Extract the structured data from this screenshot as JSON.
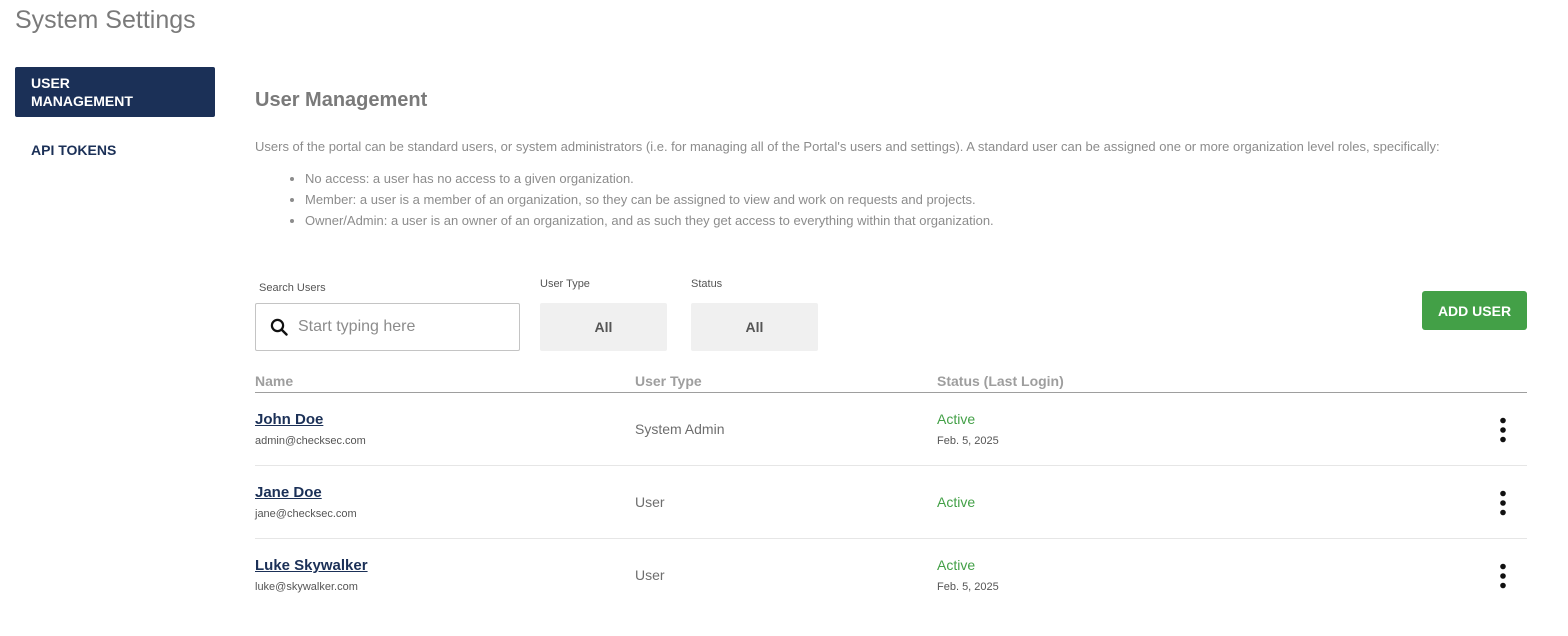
{
  "page": {
    "title": "System Settings"
  },
  "sidebar": {
    "items": [
      {
        "label_line1": "USER",
        "label_line2": "MANAGEMENT",
        "active": true
      },
      {
        "label": "API TOKENS",
        "active": false
      }
    ]
  },
  "main": {
    "title": "User Management",
    "intro": "Users of the portal can be standard users, or system administrators (i.e. for managing all of the Portal's users and settings). A standard user can be assigned one or more organization level roles, specifically:",
    "roles": [
      "No access: a user has no access to a given organization.",
      "Member: a user is a member of an organization, so they can be assigned to view and work on requests and projects.",
      "Owner/Admin: a user is an owner of an organization, and as such they get access to everything within that organization."
    ]
  },
  "filters": {
    "search_label": "Search Users",
    "search_placeholder": "Start typing here",
    "search_value": "",
    "user_type_label": "User Type",
    "user_type_value": "All",
    "status_label": "Status",
    "status_value": "All"
  },
  "actions": {
    "add_user": "ADD USER"
  },
  "table": {
    "columns": [
      "Name",
      "User Type",
      "Status (Last Login)"
    ],
    "rows": [
      {
        "name": "John Doe",
        "email": "admin@checksec.com",
        "user_type": "System Admin",
        "status": "Active",
        "last_login": "Feb. 5, 2025"
      },
      {
        "name": "Jane Doe",
        "email": "jane@checksec.com",
        "user_type": "User",
        "status": "Active",
        "last_login": ""
      },
      {
        "name": "Luke Skywalker",
        "email": "luke@skywalker.com",
        "user_type": "User",
        "status": "Active",
        "last_login": "Feb. 5, 2025"
      }
    ]
  },
  "colors": {
    "brand_navy": "#1b3057",
    "success_green": "#43a047",
    "filter_bg": "#f0f0f0"
  },
  "icons": {
    "search": "search-icon",
    "row_menu": "more-vertical-icon"
  }
}
